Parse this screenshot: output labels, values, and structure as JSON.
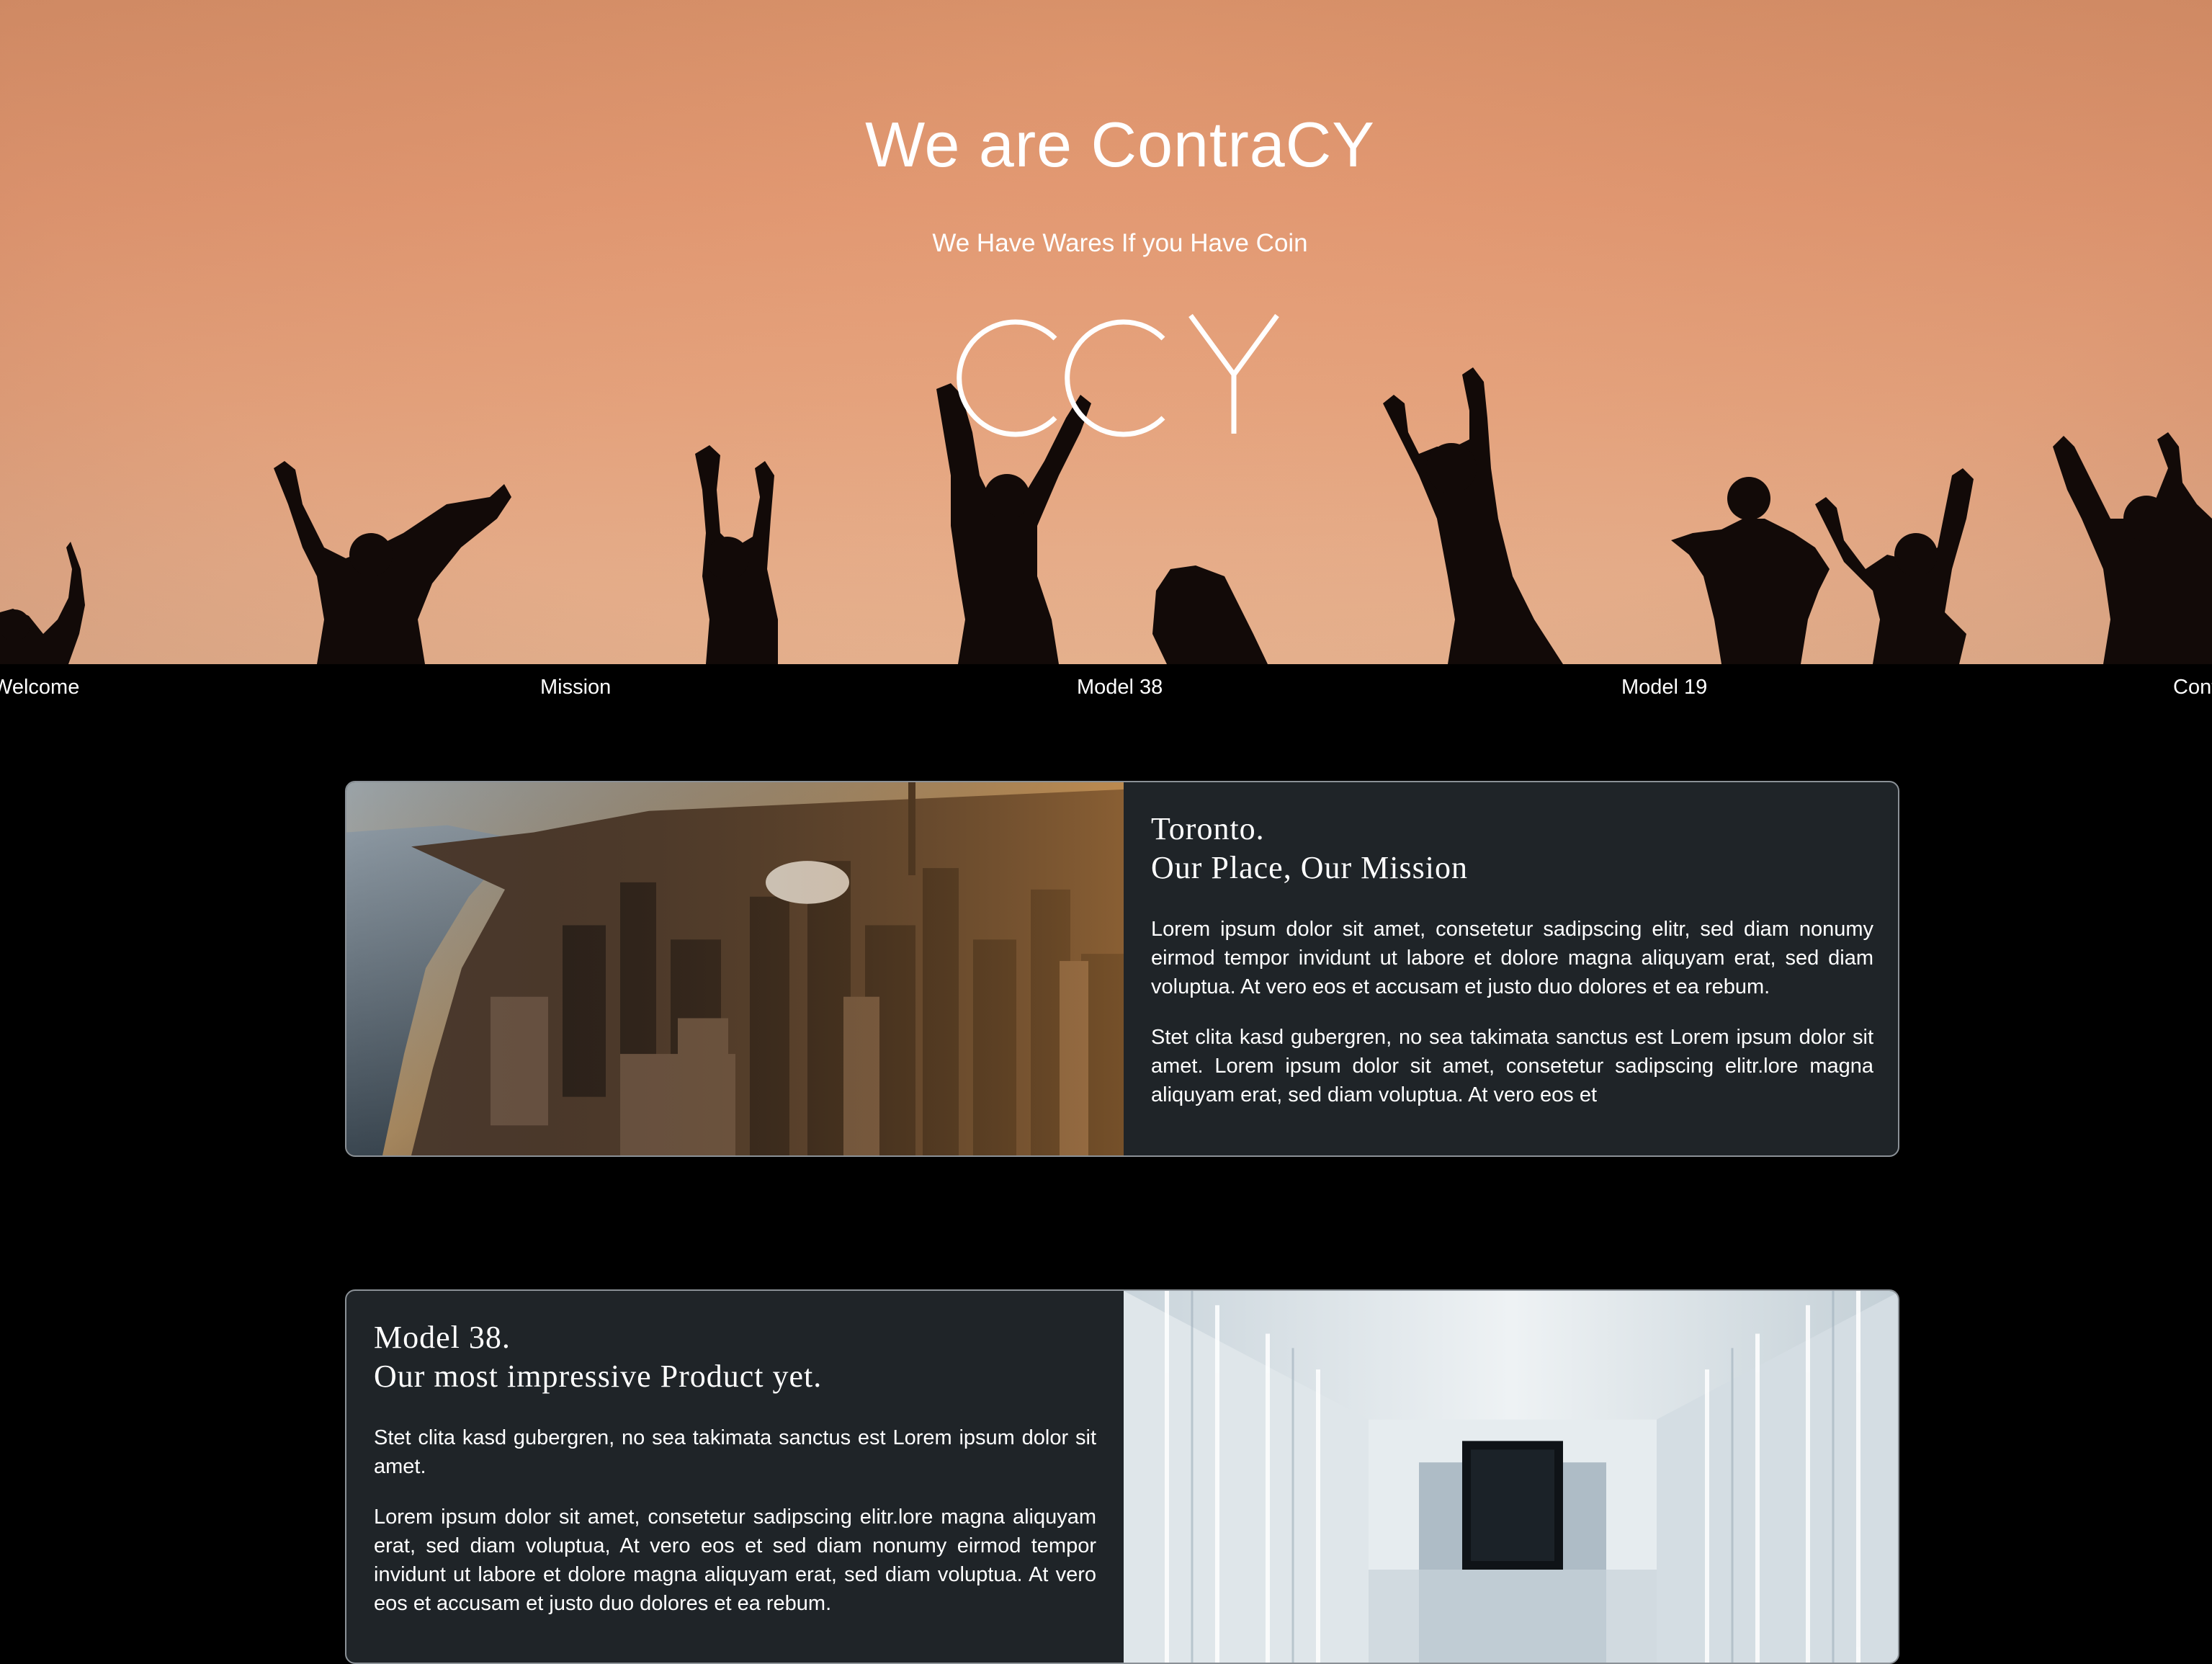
{
  "hero": {
    "title": "We are ContraCY",
    "subtitle": "We Have Wares If you Have Coin",
    "logo_text": "CCY",
    "colors": {
      "sky_top": "#d9926a",
      "sky_bottom": "#f1bd98",
      "silhouette": "#120a08"
    }
  },
  "nav": {
    "items": [
      {
        "label": "Welcome"
      },
      {
        "label": "Mission"
      },
      {
        "label": "Model 38"
      },
      {
        "label": "Model 19"
      },
      {
        "label": "Contact"
      }
    ]
  },
  "sections": {
    "toronto": {
      "heading_line1": "Toronto.",
      "heading_line2": "Our Place, Our Mission",
      "paragraph1": "Lorem ipsum dolor sit amet, consetetur sadipscing elitr, sed diam nonumy eirmod tempor invidunt ut labore et dolore magna aliquyam erat, sed diam voluptua. At vero eos et accusam et justo duo dolores et ea rebum.",
      "paragraph2": "Stet clita kasd gubergren, no sea takimata sanctus est Lorem ipsum dolor sit amet. Lorem ipsum dolor sit amet, consetetur sadipscing elitr.lore magna aliquyam erat, sed diam voluptua. At vero eos et",
      "image": "aerial-city-photo"
    },
    "model38": {
      "heading_line1": "Model 38.",
      "heading_line2": "Our most impressive Product yet.",
      "paragraph1": "Stet clita kasd gubergren, no sea takimata sanctus est Lorem ipsum dolor sit amet.",
      "paragraph2": "Lorem ipsum dolor sit amet, consetetur sadipscing elitr.lore magna aliquyam erat, sed diam voluptua, At vero eos et sed diam nonumy eirmod tempor invidunt ut labore et dolore magna aliquyam erat, sed diam voluptua. At vero eos et accusam et justo duo dolores et ea rebum.",
      "image": "white-corridor-photo"
    }
  },
  "colors": {
    "page_background": "#000000",
    "card_background": "#1f2428",
    "card_border": "#8b9197",
    "text": "#ffffff"
  }
}
